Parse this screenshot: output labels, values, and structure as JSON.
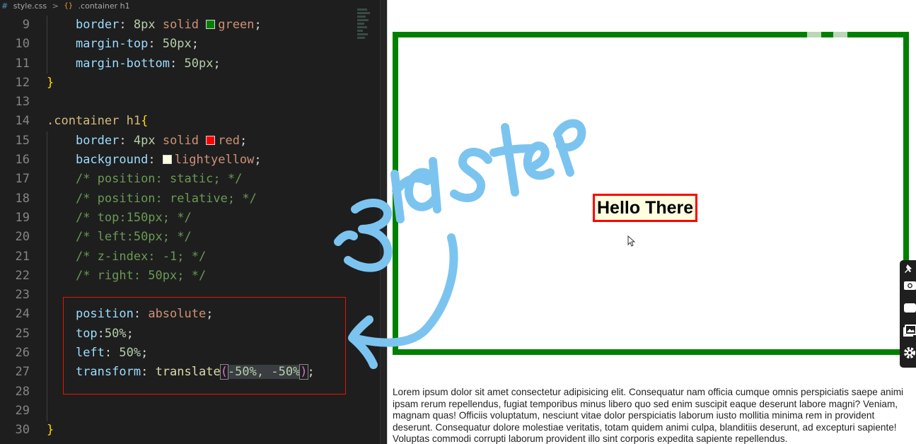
{
  "breadcrumb": {
    "file_icon": "#",
    "file": "style.css",
    "sep": ">",
    "symbol_icon": "{}",
    "symbol": ".container h1"
  },
  "code_lines": [
    {
      "n": "9",
      "indent": "    ",
      "parts": [
        [
          "prop",
          "border"
        ],
        [
          "punc",
          ": "
        ],
        [
          "num",
          "8px"
        ],
        [
          "punc",
          " "
        ],
        [
          "val",
          "solid"
        ],
        [
          "punc",
          " "
        ],
        [
          "swatch",
          "#008000"
        ],
        [
          "val",
          "green"
        ],
        [
          "punc",
          ";"
        ]
      ]
    },
    {
      "n": "10",
      "indent": "    ",
      "parts": [
        [
          "prop",
          "margin-top"
        ],
        [
          "punc",
          ": "
        ],
        [
          "num",
          "50px"
        ],
        [
          "punc",
          ";"
        ]
      ]
    },
    {
      "n": "11",
      "indent": "    ",
      "parts": [
        [
          "prop",
          "margin-bottom"
        ],
        [
          "punc",
          ": "
        ],
        [
          "num",
          "50px"
        ],
        [
          "punc",
          ";"
        ]
      ]
    },
    {
      "n": "12",
      "indent": "",
      "parts": [
        [
          "brace",
          "}"
        ]
      ]
    },
    {
      "n": "13",
      "indent": "",
      "parts": []
    },
    {
      "n": "14",
      "indent": "",
      "parts": [
        [
          "sel",
          ".container h1"
        ],
        [
          "brace",
          "{"
        ]
      ]
    },
    {
      "n": "15",
      "indent": "    ",
      "parts": [
        [
          "prop",
          "border"
        ],
        [
          "punc",
          ": "
        ],
        [
          "num",
          "4px"
        ],
        [
          "punc",
          " "
        ],
        [
          "val",
          "solid"
        ],
        [
          "punc",
          " "
        ],
        [
          "swatch",
          "#ff0000"
        ],
        [
          "val",
          "red"
        ],
        [
          "punc",
          ";"
        ]
      ]
    },
    {
      "n": "16",
      "indent": "    ",
      "parts": [
        [
          "prop",
          "background"
        ],
        [
          "punc",
          ": "
        ],
        [
          "swatch",
          "#ffffe0"
        ],
        [
          "val",
          "lightyellow"
        ],
        [
          "punc",
          ";"
        ]
      ]
    },
    {
      "n": "17",
      "indent": "    ",
      "parts": [
        [
          "cmt",
          "/* position: static; */"
        ]
      ]
    },
    {
      "n": "18",
      "indent": "    ",
      "parts": [
        [
          "cmt",
          "/* position: relative; */"
        ]
      ]
    },
    {
      "n": "19",
      "indent": "    ",
      "parts": [
        [
          "cmt",
          "/* top:150px; */"
        ]
      ]
    },
    {
      "n": "20",
      "indent": "    ",
      "parts": [
        [
          "cmt",
          "/* left:50px; */"
        ]
      ]
    },
    {
      "n": "21",
      "indent": "    ",
      "parts": [
        [
          "cmt",
          "/* z-index: -1; */"
        ]
      ]
    },
    {
      "n": "22",
      "indent": "    ",
      "parts": [
        [
          "cmt",
          "/* right: 50px; */"
        ]
      ]
    },
    {
      "n": "23",
      "indent": "",
      "parts": []
    },
    {
      "n": "24",
      "indent": "    ",
      "parts": [
        [
          "prop",
          "position"
        ],
        [
          "punc",
          ": "
        ],
        [
          "val",
          "absolute"
        ],
        [
          "punc",
          ";"
        ]
      ]
    },
    {
      "n": "25",
      "indent": "    ",
      "parts": [
        [
          "prop",
          "top"
        ],
        [
          "punc",
          ":"
        ],
        [
          "num",
          "50%"
        ],
        [
          "punc",
          ";"
        ]
      ]
    },
    {
      "n": "26",
      "indent": "    ",
      "parts": [
        [
          "prop",
          "left"
        ],
        [
          "punc",
          ": "
        ],
        [
          "num",
          "50%"
        ],
        [
          "punc",
          ";"
        ]
      ]
    },
    {
      "n": "27",
      "indent": "    ",
      "parts": [
        [
          "prop",
          "transform"
        ],
        [
          "punc",
          ": "
        ],
        [
          "fn",
          "translate"
        ],
        [
          "paren",
          "("
        ],
        [
          "inner",
          "-50%, -50%"
        ],
        [
          "paren",
          ")"
        ],
        [
          "punc",
          ";"
        ]
      ]
    },
    {
      "n": "28",
      "indent": "",
      "parts": []
    },
    {
      "n": "29",
      "indent": "",
      "parts": []
    },
    {
      "n": "30",
      "indent": "",
      "parts": [
        [
          "brace",
          "}"
        ]
      ]
    }
  ],
  "preview": {
    "heading": "Hello There",
    "paragraph": "Lorem ipsum dolor sit amet consectetur adipisicing elit. Consequatur nam officia cumque omnis perspiciatis saepe animi ipsam rerum repellendus, fugiat temporibus minus libero quo sed enim suscipit eaque deserunt labore magni? Veniam, magnam quas! Officiis voluptatum, nesciunt vitae dolor perspiciatis laborum iusto mollitia minima rem in provident deserunt. Consequatur dolore molestiae veritatis, totam quidem animi culpa, blanditiis deserunt, ad excepturi sapiente! Voluptas commodi corrupti laborum provident illo sint corporis expedita sapiente repellendus.",
    "container_border_color": "#008000",
    "heading_border_color": "#ff0000",
    "heading_background": "#ffffe0"
  },
  "annotation": {
    "handwritten_text": "3rd step",
    "ink_color": "#7cc4f0",
    "highlight_box_color": "#e51400"
  },
  "side_tools": [
    "pin-icon",
    "camera-icon",
    "video-icon",
    "gallery-icon",
    "settings-icon"
  ]
}
